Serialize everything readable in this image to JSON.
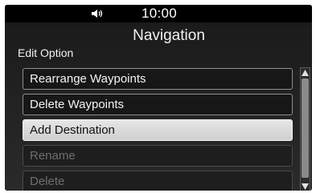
{
  "status_bar": {
    "volume_icon": "speaker-icon",
    "time": "10:00"
  },
  "header": {
    "title": "Navigation",
    "subtitle": "Edit Option"
  },
  "menu": {
    "items": [
      {
        "label": "Rearrange Waypoints",
        "state": "enabled"
      },
      {
        "label": "Delete Waypoints",
        "state": "enabled"
      },
      {
        "label": "Add Destination",
        "state": "selected"
      },
      {
        "label": "Rename",
        "state": "disabled"
      },
      {
        "label": "Delete",
        "state": "disabled"
      }
    ]
  },
  "scrollbar": {
    "up_icon": "scroll-up-arrow-icon",
    "down_icon": "scroll-down-arrow-icon"
  }
}
